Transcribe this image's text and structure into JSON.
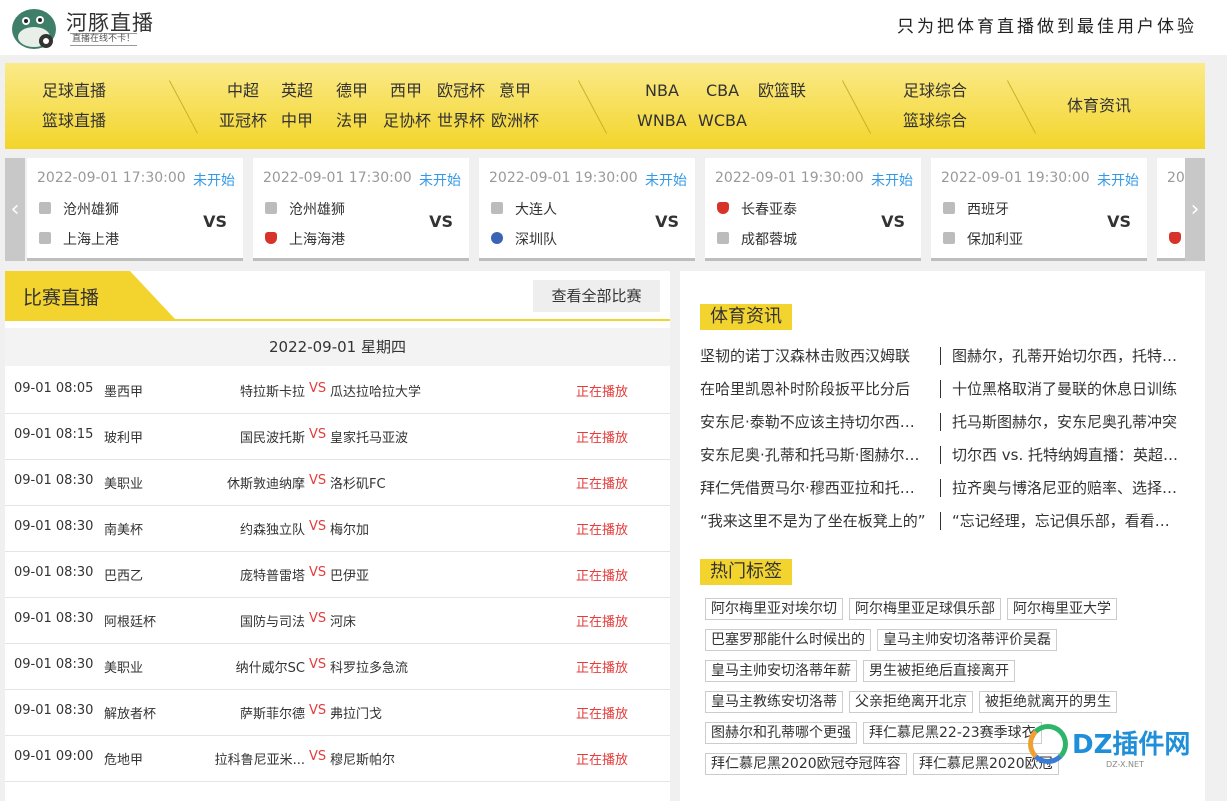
{
  "header": {
    "logo_title": "河豚直播",
    "logo_sub": "直播在线不卡！",
    "slogan": "只为把体育直播做到最佳用户体验"
  },
  "nav": {
    "group1": [
      "足球直播",
      "篮球直播"
    ],
    "group2_row1": [
      "中超",
      "英超",
      "德甲",
      "西甲",
      "欧冠杯",
      "意甲"
    ],
    "group2_row2": [
      "亚冠杯",
      "中甲",
      "法甲",
      "足协杯",
      "世界杯",
      "欧洲杯"
    ],
    "group3_row1": [
      "NBA",
      "CBA",
      "欧篮联"
    ],
    "group3_row2": [
      "WNBA",
      "WCBA"
    ],
    "group4": [
      "足球综合",
      "篮球综合"
    ],
    "news": "体育资讯"
  },
  "carousel": {
    "prev_icon": "chevron-left-icon",
    "next_icon": "chevron-right-icon",
    "matches": [
      {
        "time": "2022-09-01 17:30:00",
        "status": "未开始",
        "home": "沧州雄狮",
        "away": "上海上港",
        "vs": "VS"
      },
      {
        "time": "2022-09-01 17:30:00",
        "status": "未开始",
        "home": "沧州雄狮",
        "away": "上海海港",
        "vs": "VS"
      },
      {
        "time": "2022-09-01 19:30:00",
        "status": "未开始",
        "home": "大连人",
        "away": "深圳队",
        "vs": "VS"
      },
      {
        "time": "2022-09-01 19:30:00",
        "status": "未开始",
        "home": "长春亚泰",
        "away": "成都蓉城",
        "vs": "VS"
      },
      {
        "time": "2022-09-01 19:30:00",
        "status": "未开始",
        "home": "西班牙",
        "away": "保加利亚",
        "vs": "VS"
      }
    ],
    "partial_time": "20"
  },
  "live": {
    "title": "比赛直播",
    "view_all": "查看全部比赛",
    "date": "2022-09-01 星期四",
    "rows": [
      {
        "time": "09-01 08:05",
        "league": "墨西甲",
        "home": "特拉斯卡拉",
        "vs": "VS",
        "away": "瓜达拉哈拉大学",
        "status": "正在播放"
      },
      {
        "time": "09-01 08:15",
        "league": "玻利甲",
        "home": "国民波托斯",
        "vs": "VS",
        "away": "皇家托马亚波",
        "status": "正在播放"
      },
      {
        "time": "09-01 08:30",
        "league": "美职业",
        "home": "休斯敦迪纳摩",
        "vs": "VS",
        "away": "洛杉矶FC",
        "status": "正在播放"
      },
      {
        "time": "09-01 08:30",
        "league": "南美杯",
        "home": "约森独立队",
        "vs": "VS",
        "away": "梅尔加",
        "status": "正在播放"
      },
      {
        "time": "09-01 08:30",
        "league": "巴西乙",
        "home": "庞特普雷塔",
        "vs": "VS",
        "away": "巴伊亚",
        "status": "正在播放"
      },
      {
        "time": "09-01 08:30",
        "league": "阿根廷杯",
        "home": "国防与司法",
        "vs": "VS",
        "away": "河床",
        "status": "正在播放"
      },
      {
        "time": "09-01 08:30",
        "league": "美职业",
        "home": "纳什威尔SC",
        "vs": "VS",
        "away": "科罗拉多急流",
        "status": "正在播放"
      },
      {
        "time": "09-01 08:30",
        "league": "解放者杯",
        "home": "萨斯菲尔德",
        "vs": "VS",
        "away": "弗拉门戈",
        "status": "正在播放"
      },
      {
        "time": "09-01 09:00",
        "league": "危地甲",
        "home": "拉科鲁尼亚米...",
        "vs": "VS",
        "away": "穆尼斯帕尔",
        "status": "正在播放"
      }
    ]
  },
  "sports_news": {
    "title": "体育资讯",
    "left": [
      "坚韧的诺丁汉森林击败西汉姆联",
      "在哈里凯恩补时阶段扳平比分后",
      "安东尼·泰勒不应该主持切尔西比赛",
      "安东尼奥·孔蒂和托马斯·图赫尔的冲突",
      "拜仁凭借贾马尔·穆西亚拉和托马斯",
      "“我来这里不是为了坐在板凳上的”"
    ],
    "right": [
      "图赫尔，孔蒂开始切尔西，托特纳姆",
      "十位黑格取消了曼联的休息日训练",
      "托马斯图赫尔，安东尼奥孔蒂冲突",
      "切尔西 vs. 托特纳姆直播：英超联赛",
      "拉齐奥与博洛尼亚的赔率、选择和预测",
      "“忘记经理，忘记俱乐部，看看球员”"
    ]
  },
  "hot_tags": {
    "title": "热门标签",
    "rows": [
      [
        "阿尔梅里亚对埃尔切",
        "阿尔梅里亚足球俱乐部",
        "阿尔梅里亚大学"
      ],
      [
        "巴塞罗那能什么时候出的",
        "皇马主帅安切洛蒂评价吴磊"
      ],
      [
        "皇马主帅安切洛蒂年薪",
        "男生被拒绝后直接离开"
      ],
      [
        "皇马主教练安切洛蒂",
        "父亲拒绝离开北京",
        "被拒绝就离开的男生"
      ],
      [
        "图赫尔和孔蒂哪个更强",
        "拜仁慕尼黑22-23赛季球衣"
      ],
      [
        "拜仁慕尼黑2020欧冠夺冠阵容",
        "拜仁慕尼黑2020欧冠"
      ]
    ]
  },
  "watermark": {
    "text": "DZ插件网",
    "sub": "DZ-X.NET"
  }
}
